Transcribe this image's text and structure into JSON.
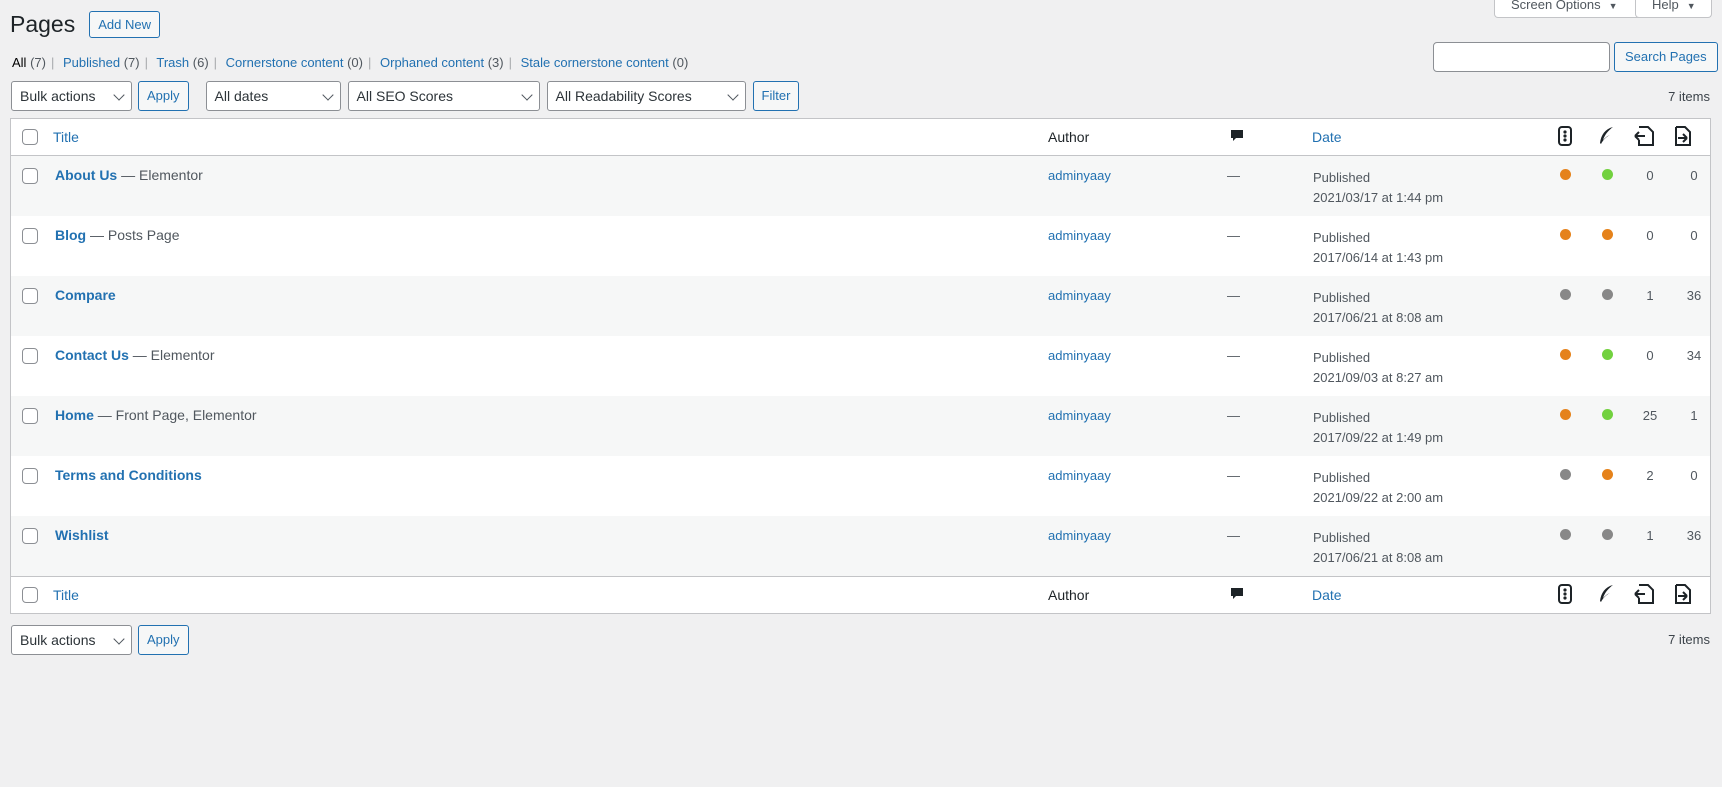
{
  "header": {
    "title": "Pages",
    "add_new_label": "Add New",
    "screen_options_label": "Screen Options",
    "help_label": "Help"
  },
  "views": [
    {
      "label": "All",
      "count": "(7)"
    },
    {
      "label": "Published",
      "count": "(7)"
    },
    {
      "label": "Trash",
      "count": "(6)"
    },
    {
      "label": "Cornerstone content",
      "count": "(0)"
    },
    {
      "label": "Orphaned content",
      "count": "(3)"
    },
    {
      "label": "Stale cornerstone content",
      "count": "(0)"
    }
  ],
  "search": {
    "button_label": "Search Pages",
    "value": ""
  },
  "filters": {
    "bulk_actions": "Bulk actions",
    "apply_label": "Apply",
    "dates": "All dates",
    "seo_scores": "All SEO Scores",
    "readability_scores": "All Readability Scores",
    "filter_label": "Filter"
  },
  "items_count": "7 items",
  "columns": {
    "title": "Title",
    "author": "Author",
    "date": "Date"
  },
  "icons": {
    "comments": "comment-bubble-icon",
    "seo": "seo-traffic-light-icon",
    "readability": "readability-feather-icon",
    "outgoing_links": "outgoing-links-icon",
    "incoming_links": "incoming-links-icon"
  },
  "colors": {
    "orange": "#e5821b",
    "green": "#72d13f",
    "gray": "#888888",
    "link": "#2271b1"
  },
  "rows": [
    {
      "title": "About Us",
      "state": " — Elementor",
      "author": "adminyaay",
      "comments": "—",
      "status": "Published",
      "date": "2021/03/17 at 1:44 pm",
      "seo": "orange",
      "readability": "green",
      "outgoing": "0",
      "incoming": "0"
    },
    {
      "title": "Blog",
      "state": " — Posts Page",
      "author": "adminyaay",
      "comments": "—",
      "status": "Published",
      "date": "2017/06/14 at 1:43 pm",
      "seo": "orange",
      "readability": "orange",
      "outgoing": "0",
      "incoming": "0"
    },
    {
      "title": "Compare",
      "state": "",
      "author": "adminyaay",
      "comments": "—",
      "status": "Published",
      "date": "2017/06/21 at 8:08 am",
      "seo": "gray",
      "readability": "gray",
      "outgoing": "1",
      "incoming": "36"
    },
    {
      "title": "Contact Us",
      "state": " — Elementor",
      "author": "adminyaay",
      "comments": "—",
      "status": "Published",
      "date": "2021/09/03 at 8:27 am",
      "seo": "orange",
      "readability": "green",
      "outgoing": "0",
      "incoming": "34"
    },
    {
      "title": "Home",
      "state": " — Front Page, Elementor",
      "author": "adminyaay",
      "comments": "—",
      "status": "Published",
      "date": "2017/09/22 at 1:49 pm",
      "seo": "orange",
      "readability": "green",
      "outgoing": "25",
      "incoming": "1"
    },
    {
      "title": "Terms and Conditions",
      "state": "",
      "author": "adminyaay",
      "comments": "—",
      "status": "Published",
      "date": "2021/09/22 at 2:00 am",
      "seo": "gray",
      "readability": "orange",
      "outgoing": "2",
      "incoming": "0"
    },
    {
      "title": "Wishlist",
      "state": "",
      "author": "adminyaay",
      "comments": "—",
      "status": "Published",
      "date": "2017/06/21 at 8:08 am",
      "seo": "gray",
      "readability": "gray",
      "outgoing": "1",
      "incoming": "36"
    }
  ]
}
